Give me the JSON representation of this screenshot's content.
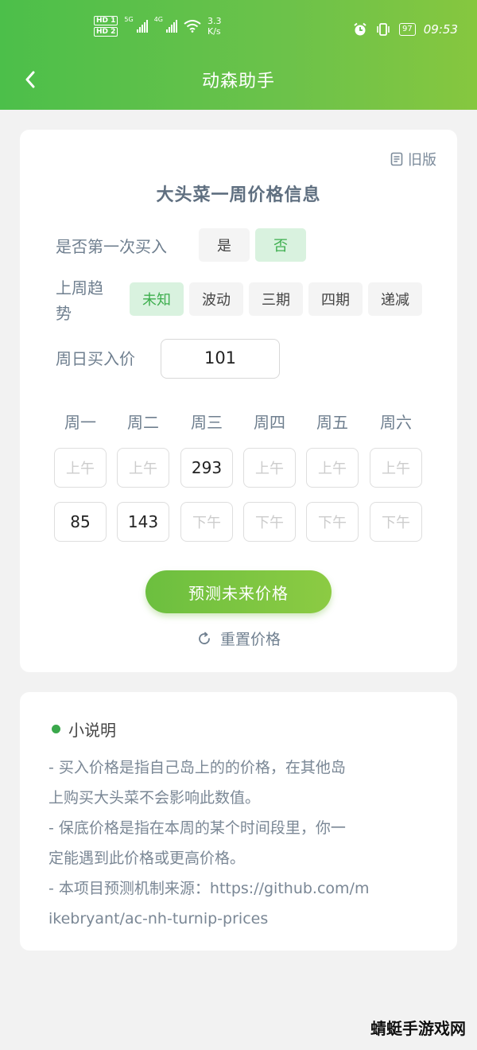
{
  "status_bar": {
    "hd1": "HD 1",
    "hd2": "HD 2",
    "net1": "5G",
    "net2": "4G",
    "wifi_level": "6",
    "speed_value": "3.3",
    "speed_unit": "K/s",
    "battery": "97",
    "time": "09:53"
  },
  "header": {
    "title": "动森助手",
    "back_icon": "chevron-left-icon"
  },
  "main": {
    "old_version_label": "旧版",
    "title": "大头菜一周价格信息",
    "first_buy": {
      "label": "是否第一次买入",
      "options": [
        "是",
        "否"
      ],
      "selected": "否"
    },
    "last_trend": {
      "label_line1": "上周趋",
      "label_line2": "势",
      "options": [
        "未知",
        "波动",
        "三期",
        "四期",
        "递减"
      ],
      "selected": "未知"
    },
    "sunday_price": {
      "label": "周日买入价",
      "value": "101"
    },
    "days": [
      "周一",
      "周二",
      "周三",
      "周四",
      "周五",
      "周六"
    ],
    "am_cells": [
      "上午",
      "上午",
      "293",
      "上午",
      "上午",
      "上午"
    ],
    "pm_cells": [
      "85",
      "143",
      "下午",
      "下午",
      "下午",
      "下午"
    ],
    "predict_button": "预测未来价格",
    "reset_label": "重置价格"
  },
  "notes": {
    "title": "小说明",
    "lines": [
      "- 买入价格是指自己岛上的的价格，在其他岛",
      "上购买大头菜不会影响此数值。",
      "- 保底价格是指在本周的某个时间段里，你一",
      "定能遇到此价格或更高价格。",
      "- 本项目预测机制来源：https://github.com/m",
      "ikebryant/ac-nh-turnip-prices"
    ]
  },
  "watermark": "蜻蜓手游戏网",
  "colors": {
    "accent": "#4cbf4a",
    "active_chip_bg": "#d9f2df",
    "active_chip_text": "#3dae4e"
  }
}
